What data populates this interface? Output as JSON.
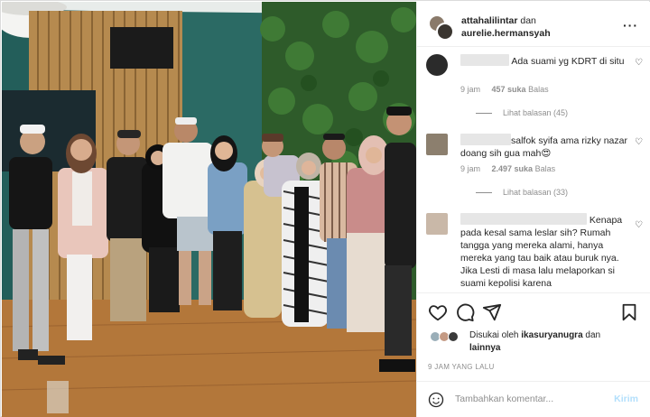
{
  "header": {
    "user1": "attahalilintar",
    "conj": "dan",
    "user2": "aurelie.hermansyah"
  },
  "comments": [
    {
      "text": "Ada suami yg KDRT di situ",
      "time": "9 jam",
      "likes": "457 suka",
      "reply": "Balas",
      "replies": "Lihat balasan (45)"
    },
    {
      "text": "salfok syifa ama rizky nazar doang sih gua mah",
      "emoji": "😍",
      "time": "9 jam",
      "likes": "2.497 suka",
      "reply": "Balas",
      "replies": "Lihat balasan (33)"
    },
    {
      "text": "Kenapa pada kesal sama leslar sih? Rumah tangga yang mereka alami, hanya mereka yang tau baik atau buruk nya. Jika Lesti di masa lalu melaporkan si suami kepolisi karena"
    }
  ],
  "liked": {
    "prefix": "Disukai oleh",
    "user": "ikasuryanugra",
    "conj": "dan",
    "others": "lainnya"
  },
  "timestamp": "9 JAM YANG LALU",
  "comment_box": {
    "placeholder": "Tambahkan komentar...",
    "send": "Kirim"
  },
  "colors": {
    "send_disabled": "#b2dffc",
    "muted": "#8e8e8e",
    "text": "#262626"
  }
}
